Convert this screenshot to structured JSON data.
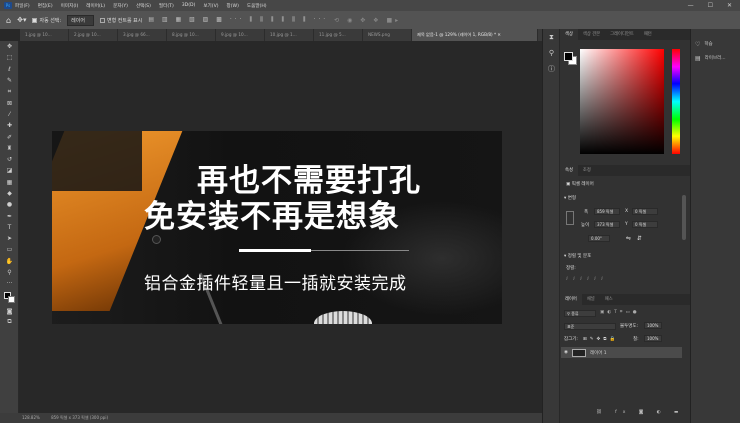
{
  "app": {
    "logo": "Ps"
  },
  "menu": [
    "파일(F)",
    "편집(E)",
    "이미지(I)",
    "레이어(L)",
    "문자(Y)",
    "선택(S)",
    "필터(T)",
    "3D(D)",
    "보기(V)",
    "창(W)",
    "도움말(H)"
  ],
  "window_controls": [
    "—",
    "☐",
    "✕"
  ],
  "options": {
    "auto_select_label": "자동 선택:",
    "auto_select_value": "레이어",
    "transform_label": "변형 컨트롤 표시"
  },
  "tabs": [
    {
      "label": "1.jpg @ 10..."
    },
    {
      "label": "2.jpg @ 10..."
    },
    {
      "label": "3.jpg @ 66..."
    },
    {
      "label": "8.jpg @ 10..."
    },
    {
      "label": "9.jpg @ 10..."
    },
    {
      "label": "10.jpg @ 1..."
    },
    {
      "label": "11.jpg @ 5..."
    },
    {
      "label": "NEWS.png"
    },
    {
      "label": "제목 없음-1 @ 129% (레이어 1, RGB/8) * ✕"
    }
  ],
  "canvas": {
    "headline_1": "再也不需要打孔",
    "headline_2": "免安装不再是想象",
    "subline": "铝合金插件轻量且一插就安装完成"
  },
  "status": {
    "zoom": "128.82%",
    "doc_info": "859 픽셀 x 373 픽셀 (300 ppi)"
  },
  "color_panel": {
    "tabs": [
      "색상",
      "색상 견본",
      "그레이디언트",
      "패턴"
    ]
  },
  "properties_panel": {
    "tabs": [
      "속성",
      "조정"
    ],
    "kind": "픽셀 레이어",
    "section_transform": "변형",
    "w_label": "폭",
    "w_value": "859 픽셀",
    "h_label": "높이",
    "h_value": "373 픽셀",
    "x_label": "X",
    "x_value": "0 픽셀",
    "y_label": "Y",
    "y_value": "0 픽셀",
    "angle": "0.00°",
    "section_align": "정렬 및 분포",
    "align_label": "정렬:"
  },
  "layers_panel": {
    "tabs": [
      "레이어",
      "채널",
      "패스"
    ],
    "filter": "종류",
    "blend": "표준",
    "opacity_label": "불투명도:",
    "opacity_value": "100%",
    "lock_label": "잠그기:",
    "fill_label": "칠:",
    "fill_value": "100%",
    "layer_name": "레이어 1"
  },
  "right_strip": {
    "items": [
      {
        "label": "학습"
      },
      {
        "label": "라이브러..."
      }
    ]
  },
  "tool_icons": [
    "move-tool-icon",
    "marquee-tool-icon",
    "lasso-tool-icon",
    "quick-select-tool-icon",
    "crop-tool-icon",
    "frame-tool-icon",
    "eyedropper-tool-icon",
    "healing-tool-icon",
    "brush-tool-icon",
    "stamp-tool-icon",
    "history-brush-tool-icon",
    "eraser-tool-icon",
    "gradient-tool-icon",
    "blur-tool-icon",
    "dodge-tool-icon",
    "pen-tool-icon",
    "type-tool-icon",
    "path-select-tool-icon",
    "shape-tool-icon",
    "hand-tool-icon",
    "zoom-tool-icon",
    "more-tools-icon"
  ]
}
